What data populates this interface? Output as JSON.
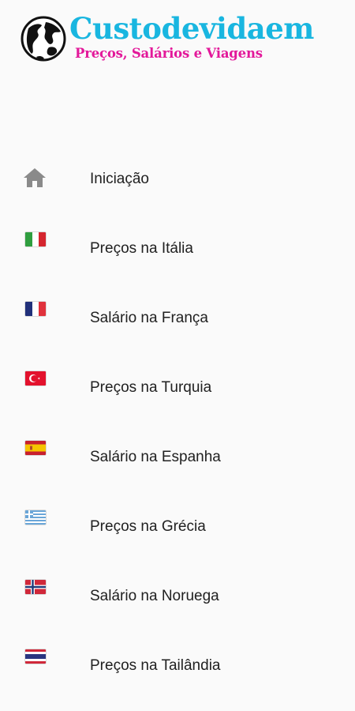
{
  "header": {
    "title": "Custodevidaem",
    "subtitle": "Preços, Salários e Viagens"
  },
  "menu": {
    "items": [
      {
        "label": "Iniciação",
        "icon": "home-icon"
      },
      {
        "label": "Preços na Itália",
        "icon": "italy-flag-icon"
      },
      {
        "label": "Salário na França",
        "icon": "france-flag-icon"
      },
      {
        "label": "Preços na Turquia",
        "icon": "turkey-flag-icon"
      },
      {
        "label": "Salário na Espanha",
        "icon": "spain-flag-icon"
      },
      {
        "label": "Preços na Grécia",
        "icon": "greece-flag-icon"
      },
      {
        "label": "Salário na Noruega",
        "icon": "norway-flag-icon"
      },
      {
        "label": "Preços na Tailândia",
        "icon": "thailand-flag-icon"
      }
    ]
  },
  "colors": {
    "title": "#19b6e0",
    "subtitle": "#e3189a",
    "text": "#212121",
    "background": "#fafafa",
    "home_icon": "#8a8a8a"
  }
}
